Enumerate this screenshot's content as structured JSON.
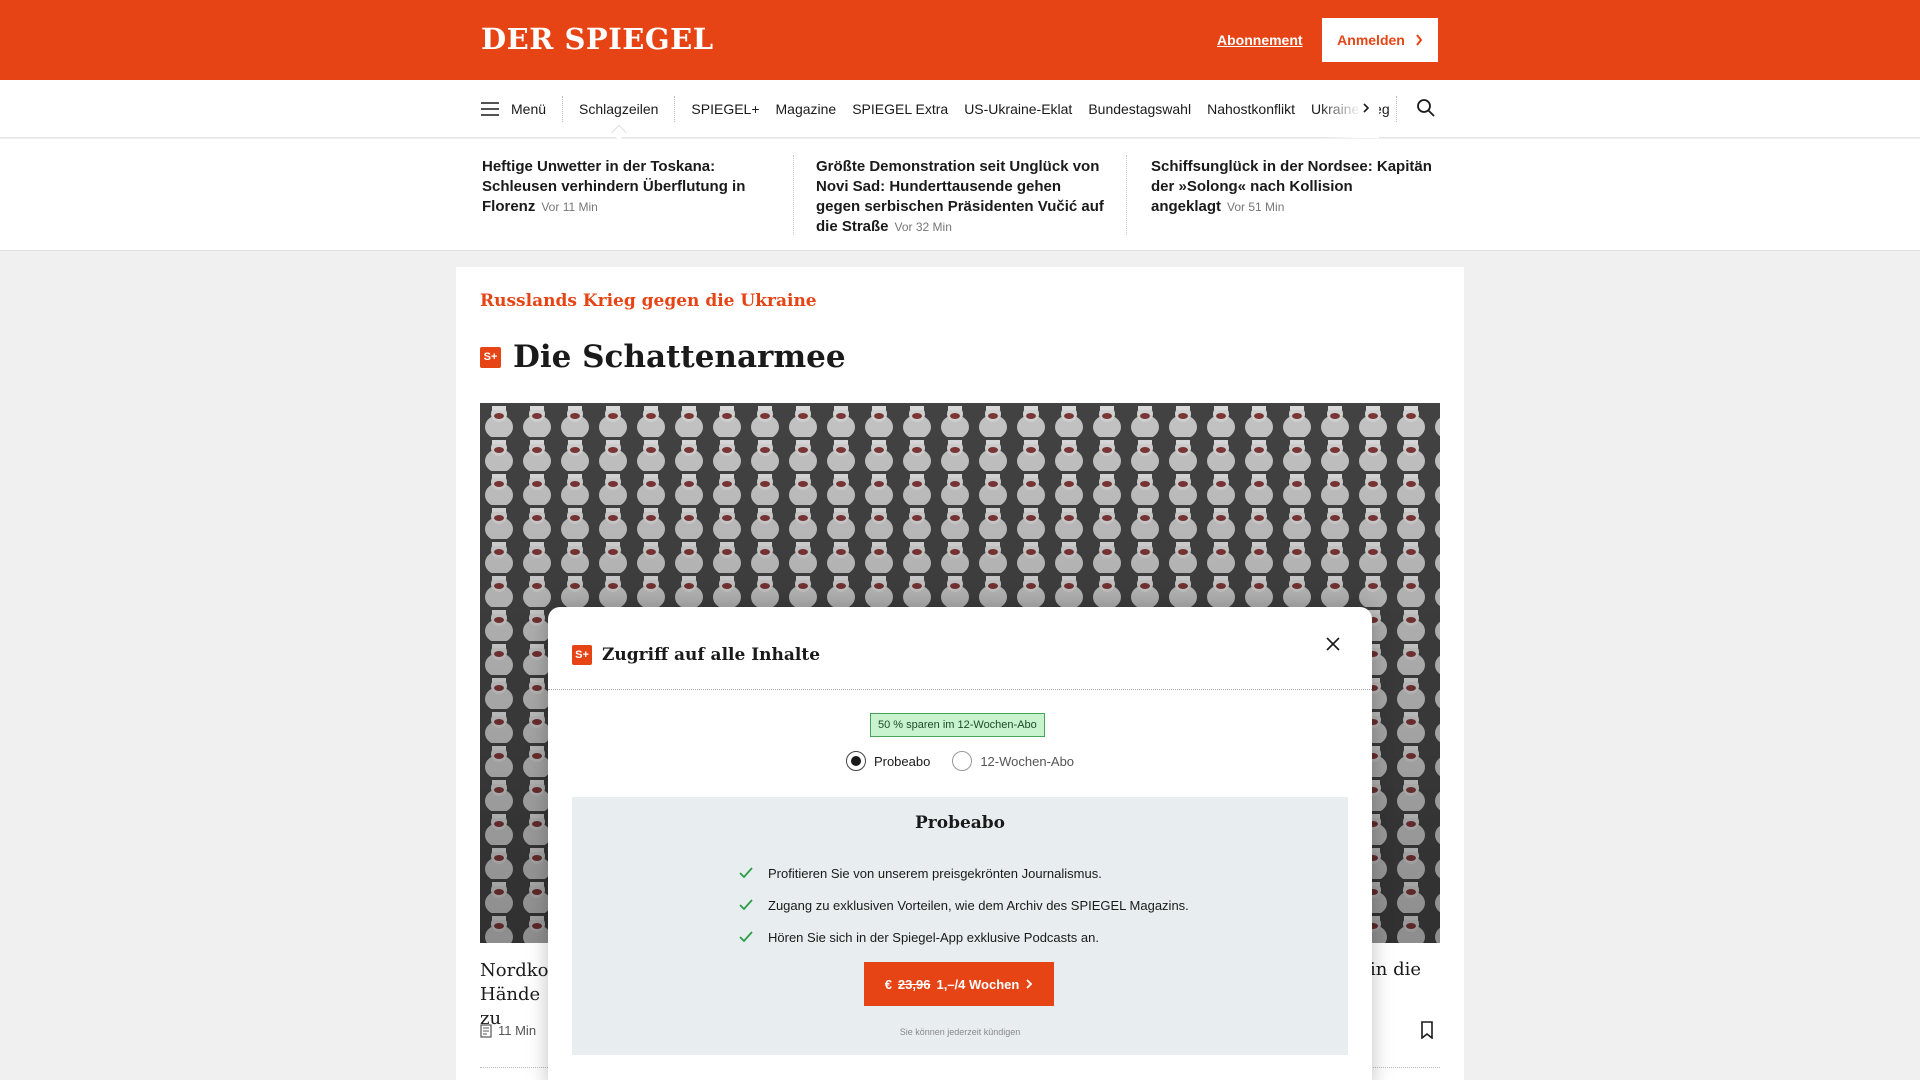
{
  "header": {
    "logo": "DER SPIEGEL",
    "subscription_link": "Abonnement",
    "login_button": "Anmelden",
    "brand_color": "#e64415"
  },
  "nav": {
    "menu_label": "Menü",
    "items": [
      "Schlagzeilen",
      "SPIEGEL+",
      "Magazine",
      "SPIEGEL Extra",
      "US-Ukraine-Eklat",
      "Bundestagswahl",
      "Nahostkonflikt",
      "Ukrainekrieg"
    ],
    "next_icon": "chevron-right-icon",
    "search_icon": "search-icon"
  },
  "headlines": [
    {
      "text": "Heftige Unwetter in der Toskana: Schleusen verhindern Überflutung in Florenz",
      "time": "Vor 11 Min"
    },
    {
      "text": "Größte Demonstration seit Unglück von Novi Sad: Hunderttausende gehen gegen serbischen Präsidenten Vučić auf die Straße",
      "time": "Vor 32 Min"
    },
    {
      "text": "Schiffsunglück in der Nordsee: Kapitän der »Solong« nach Kollision angeklagt",
      "time": "Vor 51 Min"
    }
  ],
  "article": {
    "kicker": "Russlands Krieg gegen die Ukraine",
    "plus_badge": "S+",
    "title": "Die Schattenarmee",
    "caption_left": "Nordkor Hände zu",
    "caption_right": "in die",
    "read_time": "11 Min"
  },
  "modal": {
    "badge": "S+",
    "title": "Zugriff auf alle Inhalte",
    "save_badge": "50 % sparen im 12-Wochen-Abo",
    "options": [
      "Probeabo",
      "12-Wochen-Abo"
    ],
    "selected_option": "Probeabo",
    "offer_title": "Probeabo",
    "benefits": [
      "Profitieren Sie von unserem preisgekrönten Journalismus.",
      "Zugang zu exklusiven Vorteilen, wie dem Archiv des SPIEGEL Magazins.",
      "Hören Sie sich in der Spiegel-App exklusive Podcasts an."
    ],
    "cta_currency": "€",
    "cta_old_price": "23,96",
    "cta_new_price": "1,–/4 Wochen",
    "cancel_note": "Sie können jederzeit kündigen"
  }
}
